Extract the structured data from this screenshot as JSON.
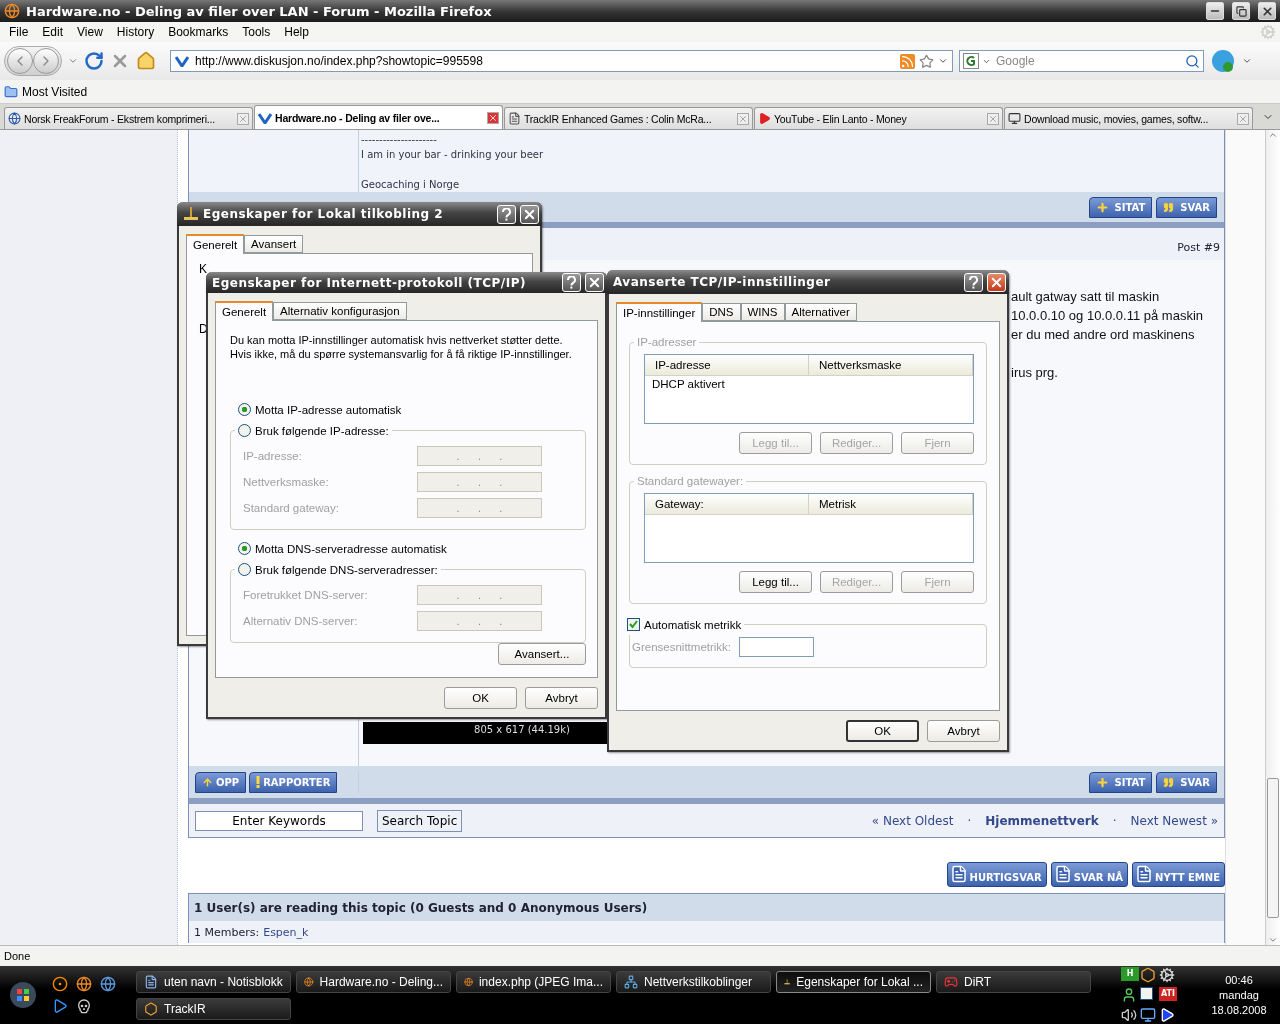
{
  "window": {
    "title": "Hardware.no - Deling av filer over LAN - Forum - Mozilla Firefox"
  },
  "menu": [
    "File",
    "Edit",
    "View",
    "History",
    "Bookmarks",
    "Tools",
    "Help"
  ],
  "navigation": {
    "url": "http://www.diskusjon.no/index.php?showtopic=995598",
    "search_placeholder": "Google"
  },
  "bookmarks": [
    "Most Visited"
  ],
  "tabs": [
    {
      "label": "Norsk FreakForum - Ekstrem komprimeri...",
      "selected": false,
      "kind": "forum"
    },
    {
      "label": "Hardware.no - Deling av filer ove...",
      "selected": true,
      "kind": "site"
    },
    {
      "label": "TrackIR Enhanced Games : Colin McRa...",
      "selected": false,
      "kind": "article"
    },
    {
      "label": "YouTube - Elin Lanto - Money",
      "selected": false,
      "kind": "video"
    },
    {
      "label": "Download music, movies, games, softw...",
      "selected": false,
      "kind": "download"
    }
  ],
  "forum": {
    "signature": [
      [
        "---------------------",
        "I am in your bar - drinking your beer"
      ],
      [
        "Geocaching i Norge"
      ]
    ],
    "post_number": "Post #9",
    "post_text": [
      [
        "ault gatway satt til maskin",
        "10.0.0.10 og 10.0.0.11 på maskin",
        "er du med andre ord maskinens"
      ],
      [
        "irus prg."
      ]
    ],
    "image_caption": "805 x 617 (44.19k)",
    "post_buttons": [
      {
        "label": "SITAT",
        "kind": "quote"
      },
      {
        "label": "SVAR",
        "kind": "reply"
      }
    ],
    "footer_left_buttons": [
      {
        "label": "OPP",
        "kind": "up"
      },
      {
        "label": "RAPPORTER",
        "kind": "report"
      }
    ],
    "footer_right_buttons": [
      {
        "label": "SITAT",
        "kind": "quote"
      },
      {
        "label": "SVAR",
        "kind": "reply"
      }
    ],
    "search": {
      "value": "Enter Keywords",
      "button": "Search Topic"
    },
    "topic_nav": [
      {
        "kind": "link",
        "label": "« Next Oldest"
      },
      {
        "kind": "separator",
        "label": "·"
      },
      {
        "kind": "current",
        "label": "Hjemmenettverk"
      },
      {
        "kind": "separator",
        "label": "·"
      },
      {
        "kind": "link",
        "label": "Next Newest »"
      }
    ],
    "action_buttons": [
      "HURTIGSVAR",
      "SVAR NÅ",
      "NYTT EMNE"
    ],
    "active_users": {
      "heading": "1 User(s) are reading this topic (0 Guests and 0 Anonymous Users)",
      "members_label": "1 Members:",
      "member": "Espen_k"
    }
  },
  "connection_dialog": {
    "title": "Egenskaper for Lokal tilkobling 2",
    "tabs": [
      {
        "label": "Generelt",
        "selected": true
      },
      {
        "label": "Avansert",
        "selected": false
      }
    ],
    "fragments": [
      "K",
      "D"
    ]
  },
  "tcpip_dialog": {
    "title": "Egenskaper for Internett-protokoll (TCP/IP)",
    "tabs": [
      {
        "label": "Generelt",
        "selected": true
      },
      {
        "label": "Alternativ konfigurasjon",
        "selected": false
      }
    ],
    "intro": "Du kan motta IP-innstillinger automatisk hvis nettverket støtter dette. Hvis ikke, må du spørre systemansvarlig for å få riktige IP-innstillinger.",
    "ip_options": [
      {
        "label": "Motta IP-adresse automatisk",
        "selected": true
      },
      {
        "label": "Bruk følgende IP-adresse:",
        "selected": false
      }
    ],
    "ip_fields": [
      {
        "label": "IP-adresse:",
        "value": ".      .      .",
        "disabled": true
      },
      {
        "label": "Nettverksmaske:",
        "value": ".      .      .",
        "disabled": true
      },
      {
        "label": "Standard gateway:",
        "value": ".      .      .",
        "disabled": true
      }
    ],
    "dns_options": [
      {
        "label": "Motta DNS-serveradresse automatisk",
        "selected": true
      },
      {
        "label": "Bruk følgende DNS-serveradresser:",
        "selected": false
      }
    ],
    "dns_fields": [
      {
        "label": "Foretrukket DNS-server:",
        "value": ".      .      .",
        "disabled": true
      },
      {
        "label": "Alternativ DNS-server:",
        "value": ".      .      .",
        "disabled": true
      }
    ],
    "advanced_button": "Avansert...",
    "buttons": [
      {
        "label": "OK",
        "default": false
      },
      {
        "label": "Avbryt",
        "default": false
      }
    ]
  },
  "advanced_dialog": {
    "title": "Avanserte TCP/IP-innstillinger",
    "tabs": [
      {
        "label": "IP-innstillinger",
        "selected": true
      },
      {
        "label": "DNS",
        "selected": false
      },
      {
        "label": "WINS",
        "selected": false
      },
      {
        "label": "Alternativer",
        "selected": false
      }
    ],
    "groups": [
      {
        "legend": "IP-adresser",
        "columns": [
          "IP-adresse",
          "Nettverksmaske"
        ],
        "rows": [
          [
            "DHCP aktivert"
          ]
        ],
        "buttons": [
          {
            "label": "Legg til...",
            "disabled": true
          },
          {
            "label": "Rediger...",
            "disabled": true
          },
          {
            "label": "Fjern",
            "disabled": true
          }
        ]
      },
      {
        "legend": "Standard gatewayer:",
        "columns": [
          "Gateway:",
          "Metrisk"
        ],
        "buttons": [
          {
            "label": "Legg til...",
            "disabled": false
          },
          {
            "label": "Rediger...",
            "disabled": true
          },
          {
            "label": "Fjern",
            "disabled": true
          }
        ]
      }
    ],
    "metric": {
      "label": "Automatisk metrikk",
      "checked": true,
      "field_label": "Grensesnittmetrikk:",
      "disabled": true
    },
    "buttons": [
      {
        "label": "OK",
        "default": true
      },
      {
        "label": "Avbryt",
        "default": false
      }
    ]
  },
  "status_bar": "Done",
  "taskbar": {
    "tasks": [
      {
        "label": "uten navn - Notisblokk",
        "selected": false,
        "kind": "notepad"
      },
      {
        "label": "Hardware.no - Deling...",
        "selected": false,
        "kind": "browser"
      },
      {
        "label": "index.php (JPEG Ima...",
        "selected": false,
        "kind": "browser"
      },
      {
        "label": "Nettverkstilkoblinger",
        "selected": false,
        "kind": "network"
      },
      {
        "label": "Egenskaper for Lokal ...",
        "selected": true,
        "kind": "properties"
      },
      {
        "label": "DiRT",
        "selected": false,
        "kind": "game"
      },
      {
        "label": "TrackIR",
        "selected": false,
        "kind": "tracker"
      }
    ],
    "tray_badges": [
      "H",
      "ATI"
    ],
    "clock": {
      "time": "00:46",
      "day": "mandag",
      "date": "18.08.2008"
    }
  }
}
